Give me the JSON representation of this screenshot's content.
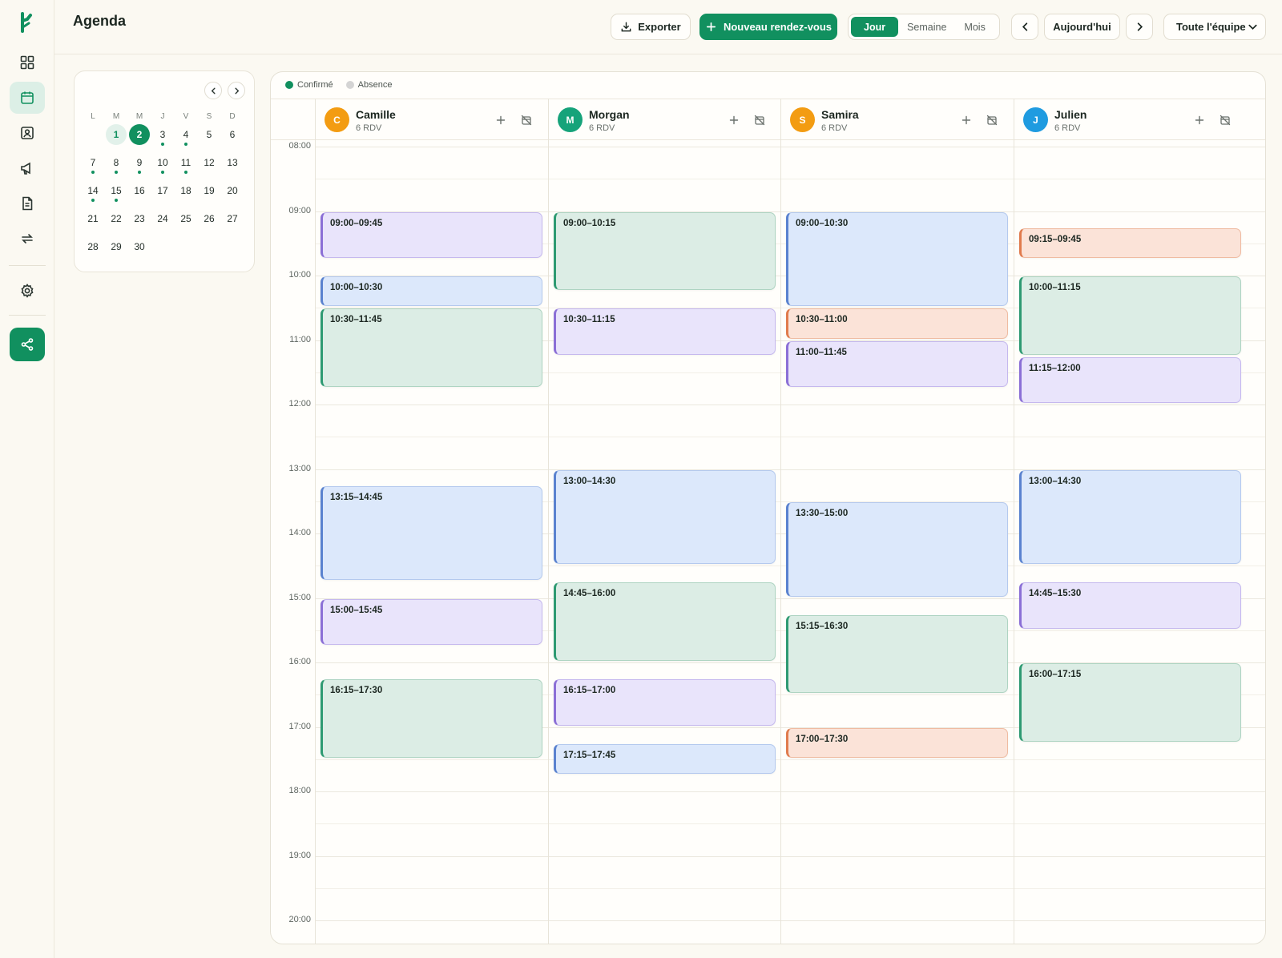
{
  "app": {
    "page_title": "Agenda"
  },
  "toolbar": {
    "export_label": "Exporter",
    "new_label": "Nouveau rendez-vous",
    "views": [
      "Jour",
      "Semaine",
      "Mois"
    ],
    "active_view": "Jour",
    "today_label": "Aujourd'hui",
    "team_filter": "Toute l'équipe"
  },
  "mini_calendar": {
    "weekdays": [
      "L",
      "M",
      "M",
      "J",
      "V",
      "S",
      "D"
    ],
    "weeks": [
      [
        "",
        "1",
        "2",
        "3",
        "4",
        "5",
        "6"
      ],
      [
        "7",
        "8",
        "9",
        "10",
        "11",
        "12",
        "13"
      ],
      [
        "14",
        "15",
        "16",
        "17",
        "18",
        "19",
        "20"
      ],
      [
        "21",
        "22",
        "23",
        "24",
        "25",
        "26",
        "27"
      ],
      [
        "28",
        "29",
        "30",
        "",
        "",
        "",
        ""
      ]
    ],
    "today": "1",
    "selected": "2",
    "days_with_events": [
      "3",
      "4",
      "7",
      "8",
      "9",
      "10",
      "11",
      "14",
      "15"
    ]
  },
  "legend": [
    {
      "label": "Confirmé",
      "color": "#11905f"
    },
    {
      "label": "Absence",
      "color": "#d4d4d4"
    }
  ],
  "time_labels": [
    "08:00",
    "09:00",
    "10:00",
    "11:00",
    "12:00",
    "13:00",
    "14:00",
    "15:00",
    "16:00",
    "17:00",
    "18:00",
    "19:00",
    "20:00"
  ],
  "staff": [
    {
      "initial": "C",
      "name": "Camille",
      "count": "6 RDV",
      "color": "#f39c12",
      "appointments": [
        {
          "label": "09:00–09:45",
          "start": 9.0,
          "end": 9.75,
          "color": "purple"
        },
        {
          "label": "10:00–10:30",
          "start": 10.0,
          "end": 10.5,
          "color": "blue"
        },
        {
          "label": "10:30–11:45",
          "start": 10.5,
          "end": 11.75,
          "color": "green"
        },
        {
          "label": "13:15–14:45",
          "start": 13.25,
          "end": 14.75,
          "color": "blue"
        },
        {
          "label": "15:00–15:45",
          "start": 15.0,
          "end": 15.75,
          "color": "purple"
        },
        {
          "label": "16:15–17:30",
          "start": 16.25,
          "end": 17.5,
          "color": "green"
        }
      ]
    },
    {
      "initial": "M",
      "name": "Morgan",
      "count": "6 RDV",
      "color": "#16a37a",
      "appointments": [
        {
          "label": "09:00–10:15",
          "start": 9.0,
          "end": 10.25,
          "color": "green"
        },
        {
          "label": "10:30–11:15",
          "start": 10.5,
          "end": 11.25,
          "color": "purple"
        },
        {
          "label": "13:00–14:30",
          "start": 13.0,
          "end": 14.5,
          "color": "blue"
        },
        {
          "label": "14:45–16:00",
          "start": 14.75,
          "end": 16.0,
          "color": "green"
        },
        {
          "label": "16:15–17:00",
          "start": 16.25,
          "end": 17.0,
          "color": "purple"
        },
        {
          "label": "17:15–17:45",
          "start": 17.25,
          "end": 17.75,
          "color": "blue"
        }
      ]
    },
    {
      "initial": "S",
      "name": "Samira",
      "count": "6 RDV",
      "color": "#f39c12",
      "appointments": [
        {
          "label": "09:00–10:30",
          "start": 9.0,
          "end": 10.5,
          "color": "blue"
        },
        {
          "label": "10:30–11:00",
          "start": 10.5,
          "end": 11.0,
          "color": "orange"
        },
        {
          "label": "11:00–11:45",
          "start": 11.0,
          "end": 11.75,
          "color": "purple"
        },
        {
          "label": "13:30–15:00",
          "start": 13.5,
          "end": 15.0,
          "color": "blue"
        },
        {
          "label": "15:15–16:30",
          "start": 15.25,
          "end": 16.5,
          "color": "green"
        },
        {
          "label": "17:00–17:30",
          "start": 17.0,
          "end": 17.5,
          "color": "orange"
        }
      ]
    },
    {
      "initial": "J",
      "name": "Julien",
      "count": "6 RDV",
      "color": "#1f9be0",
      "appointments": [
        {
          "label": "09:15–09:45",
          "start": 9.25,
          "end": 9.75,
          "color": "orange"
        },
        {
          "label": "10:00–11:15",
          "start": 10.0,
          "end": 11.25,
          "color": "green"
        },
        {
          "label": "11:15–12:00",
          "start": 11.25,
          "end": 12.0,
          "color": "purple"
        },
        {
          "label": "13:00–14:30",
          "start": 13.0,
          "end": 14.5,
          "color": "blue"
        },
        {
          "label": "14:45–15:30",
          "start": 14.75,
          "end": 15.5,
          "color": "purple"
        },
        {
          "label": "16:00–17:15",
          "start": 16.0,
          "end": 17.25,
          "color": "green"
        }
      ]
    }
  ]
}
